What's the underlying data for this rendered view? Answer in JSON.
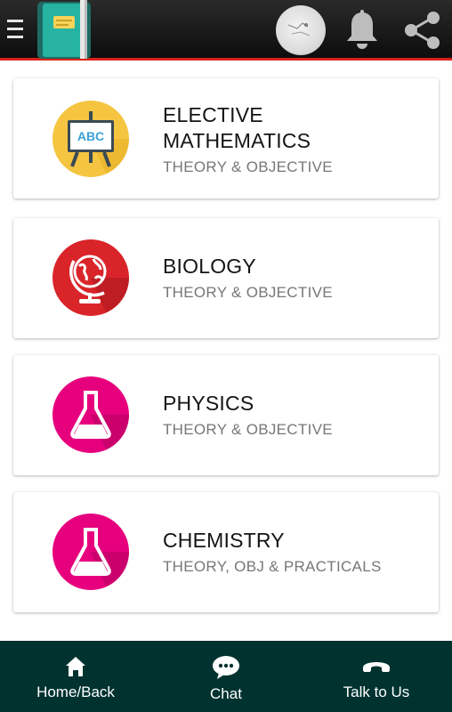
{
  "header": {
    "icons": [
      "menu-icon",
      "notebook-logo",
      "avatar",
      "bell-icon",
      "share-icon"
    ]
  },
  "subjects": [
    {
      "title_line1": "ELECTIVE",
      "title_line2": "MATHEMATICS",
      "subtitle": "THEORY & OBJECTIVE",
      "icon": "easel-abc-icon",
      "icon_color": "#f5c541"
    },
    {
      "title_line1": "BIOLOGY",
      "subtitle": "THEORY & OBJECTIVE",
      "icon": "globe-icon",
      "icon_color": "#d9252a"
    },
    {
      "title_line1": "PHYSICS",
      "subtitle": "THEORY & OBJECTIVE",
      "icon": "flask-icon",
      "icon_color": "#e6007e"
    },
    {
      "title_line1": "CHEMISTRY",
      "subtitle": "THEORY, OBJ & PRACTICALS",
      "icon": "flask-icon",
      "icon_color": "#e6007e"
    }
  ],
  "easel_text": "ABC",
  "bottom_nav": {
    "home": "Home/Back",
    "chat": "Chat",
    "talk": "Talk to Us"
  },
  "colors": {
    "topbar": "#111111",
    "topbar_accent": "#d8231a",
    "bottom_nav": "#003330"
  }
}
